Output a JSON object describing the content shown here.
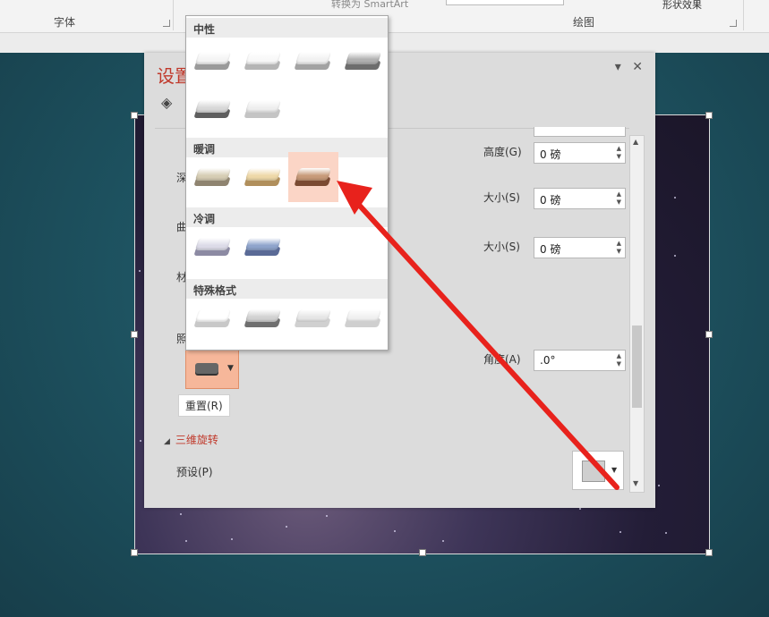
{
  "ribbon": {
    "font_group": "字体",
    "drawing_group": "绘图",
    "smartart_label": "转换为 SmartArt",
    "shape_effects_label": "形状效果"
  },
  "pane": {
    "title": "设置",
    "partial_labels": {
      "depth": "深",
      "contour": "曲",
      "material": "材",
      "lighting": "照"
    },
    "height_label": "高度(G)",
    "height_value": "0 磅",
    "size1_label": "大小(S)",
    "size1_value": "0 磅",
    "size2_label": "大小(S)",
    "size2_value": "0 磅",
    "angle_label": "角度(A)",
    "angle_value": ".0°",
    "reset_label": "重置(R)",
    "section_3d_rotation": "三维旋转",
    "preset_label": "预设(P)"
  },
  "gallery": {
    "sections": [
      {
        "name": "中性",
        "swatches": [
          {
            "top": "#f4f4f4",
            "base": "#9a9a9a"
          },
          {
            "top": "#f8f8f8",
            "base": "#b5b5b5"
          },
          {
            "top": "#f1f1f1",
            "base": "#a3a3a3"
          },
          {
            "top": "#b0b0b0",
            "base": "#6d6d6d"
          },
          {
            "top": "#d8d8d8",
            "base": "#5e5e5e"
          },
          {
            "top": "#eeeeee",
            "base": "#c4c4c4"
          }
        ]
      },
      {
        "name": "暖调",
        "swatches": [
          {
            "top": "#d6cdb4",
            "base": "#8f8470"
          },
          {
            "top": "#eed8a8",
            "base": "#b08f5c"
          },
          {
            "top": "#c79a79",
            "base": "#7a4a32",
            "selected": true
          }
        ]
      },
      {
        "name": "冷调",
        "swatches": [
          {
            "top": "#dcdbe8",
            "base": "#8c8aa3"
          },
          {
            "top": "#8fa4cc",
            "base": "#5a6a96"
          }
        ]
      },
      {
        "name": "特殊格式",
        "swatches": [
          {
            "top": "#ffffff",
            "base": "#c8c8c8"
          },
          {
            "top": "#d2d2d2",
            "base": "#6f6f6f"
          },
          {
            "top": "#e6e6e6",
            "base": "#d0d0d0"
          },
          {
            "top": "#f0f0f0",
            "base": "#cfcfcf"
          }
        ]
      }
    ]
  },
  "colors": {
    "accent_red": "#c0392b",
    "arrow_red": "#e8221c",
    "selected_bg": "#fbd5c6"
  }
}
